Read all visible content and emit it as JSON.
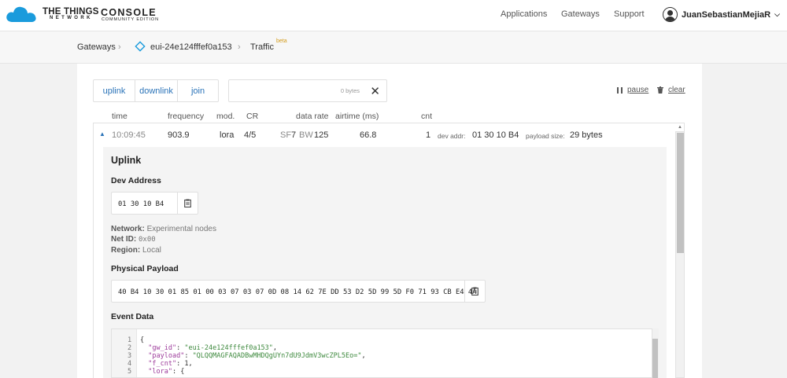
{
  "header": {
    "brand_line1": "THE THINGS",
    "brand_line2": "NETWORK",
    "brand_console": "CONSOLE",
    "brand_edition": "COMMUNITY EDITION",
    "nav": [
      "Applications",
      "Gateways",
      "Support"
    ],
    "user": "JuanSebastianMejiaR"
  },
  "breadcrumb": {
    "gateways": "Gateways",
    "gateway_id": "eui-24e124fffef0a153",
    "traffic": "Traffic",
    "beta": "beta"
  },
  "toolbar": {
    "filters": [
      "uplink",
      "downlink",
      "join"
    ],
    "search_count": "0 bytes",
    "pause": "pause",
    "clear": "clear"
  },
  "columns": {
    "time": "time",
    "frequency": "frequency",
    "mod": "mod.",
    "cr": "CR",
    "data_rate": "data rate",
    "airtime": "airtime (ms)",
    "cnt": "cnt"
  },
  "message": {
    "time": "10:09:45",
    "frequency": "903.9",
    "mod": "lora",
    "cr": "4/5",
    "sf_label": "SF",
    "sf": "7",
    "bw_label": "BW",
    "bw": "125",
    "airtime": "66.8",
    "cnt": "1",
    "dev_addr_label": "dev addr:",
    "dev_addr": "01 30 10 B4",
    "payload_size_label": "payload size:",
    "payload_size": "29 bytes"
  },
  "detail": {
    "title": "Uplink",
    "dev_address_label": "Dev Address",
    "dev_address": "01 30 10 B4",
    "network_label": "Network:",
    "network": "Experimental nodes",
    "net_id_label": "Net ID:",
    "net_id": "0x00",
    "region_label": "Region:",
    "region": "Local",
    "physical_payload_label": "Physical Payload",
    "physical_payload": "40 B4 10 30 01 85 01 00 03 07 03 07 0D 08 14 62 7E DD 53 D2 5D 99 5D F0 71 93 CB E4 4A",
    "event_data_label": "Event Data",
    "event_lines": [
      {
        "n": "1",
        "text": "{"
      },
      {
        "n": "2",
        "key": "\"gw_id\"",
        "sep": ": ",
        "val": "\"eui-24e124fffef0a153\"",
        "end": ","
      },
      {
        "n": "3",
        "key": "\"payload\"",
        "sep": ": ",
        "val": "\"QLQQMAGFAQADBwMHDQgUYn7dU9JdmV3wcZPL5Eo=\"",
        "end": ","
      },
      {
        "n": "4",
        "key": "\"f_cnt\"",
        "sep": ": ",
        "val": "1",
        "end": ","
      },
      {
        "n": "5",
        "key": "\"lora\"",
        "sep": ": ",
        "val": "{",
        "end": ""
      }
    ]
  }
}
